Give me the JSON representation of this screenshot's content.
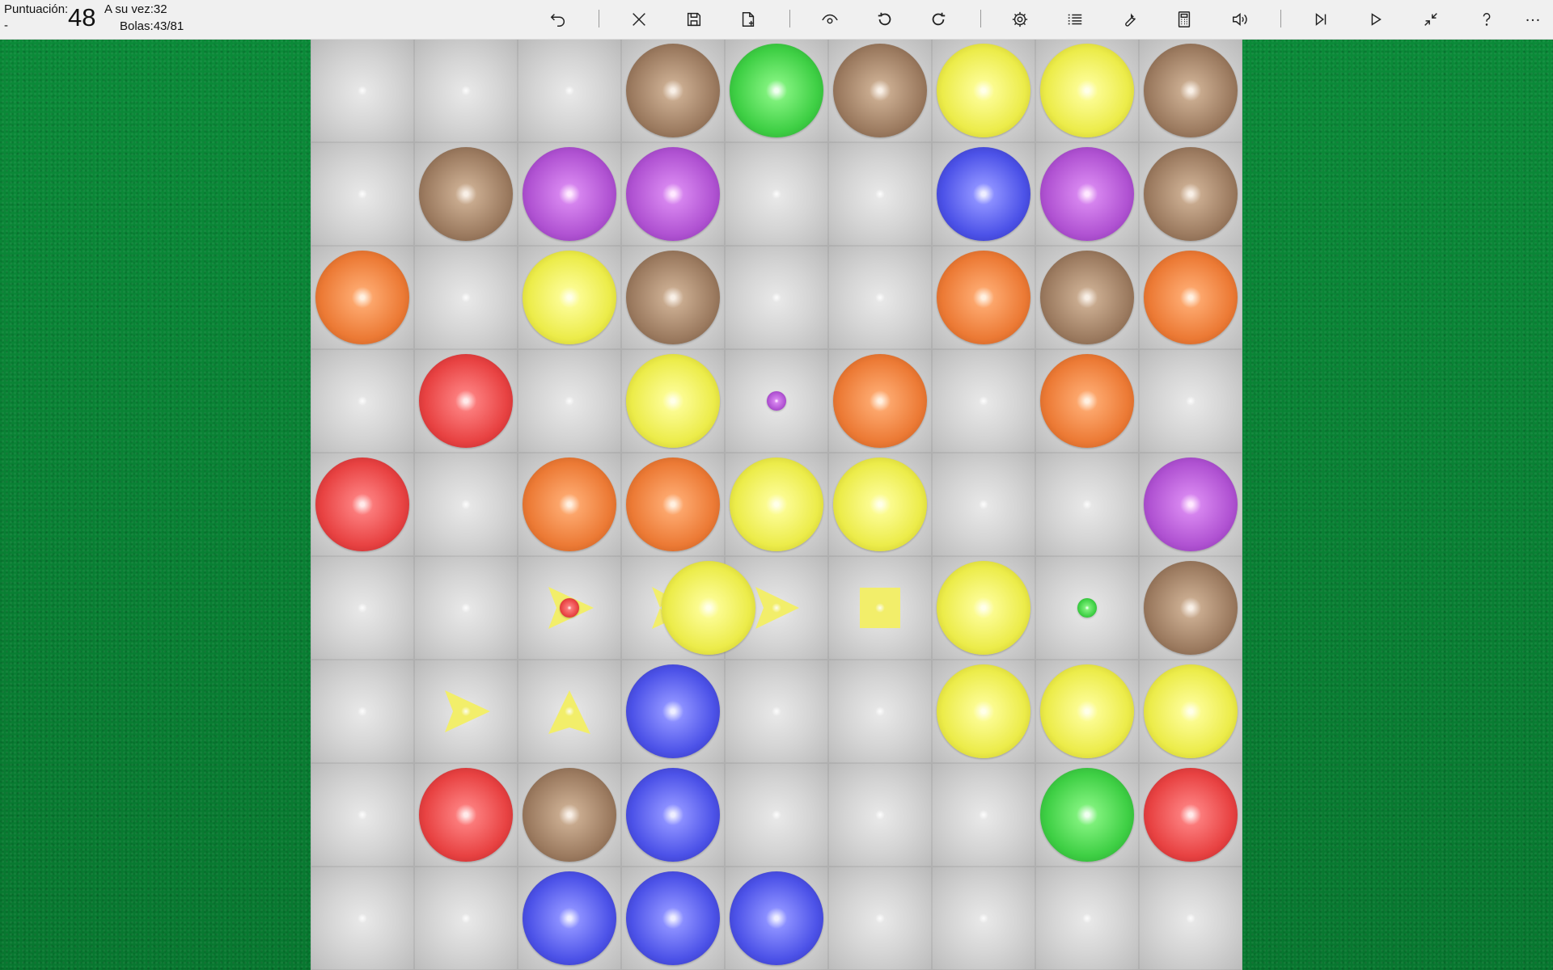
{
  "header": {
    "score_label": "Puntuación:",
    "score_value": "48",
    "score_dash": "-",
    "turn_text": "A su vez:32",
    "balls_text": "Bolas:43/81"
  },
  "toolbar": {
    "buttons": [
      {
        "name": "undo",
        "icon": "undo-icon"
      },
      {
        "name": "close",
        "icon": "close-icon"
      },
      {
        "name": "save",
        "icon": "save-icon"
      },
      {
        "name": "new-document",
        "icon": "document-icon"
      },
      {
        "name": "show",
        "icon": "eye-icon"
      },
      {
        "name": "rotate-left",
        "icon": "rotate-ccw-icon"
      },
      {
        "name": "rotate-right",
        "icon": "rotate-cw-icon"
      },
      {
        "name": "settings",
        "icon": "gear-icon"
      },
      {
        "name": "list",
        "icon": "list-icon"
      },
      {
        "name": "tools",
        "icon": "wrench-icon"
      },
      {
        "name": "calculator",
        "icon": "calculator-icon"
      },
      {
        "name": "sound",
        "icon": "speaker-icon"
      },
      {
        "name": "skip-next",
        "icon": "skip-next-icon"
      },
      {
        "name": "play",
        "icon": "play-icon"
      },
      {
        "name": "minimize",
        "icon": "shrink-icon"
      },
      {
        "name": "help",
        "icon": "question-icon"
      },
      {
        "name": "more",
        "icon": "more-icon"
      }
    ]
  },
  "colors": {
    "brown": [
      "#f8efe6",
      "#c7a98d",
      "#9c7b60",
      "#6a4e39"
    ],
    "green": [
      "#f0fff0",
      "#7df07a",
      "#3ecf44",
      "#21922a"
    ],
    "yellow": [
      "#ffffe8",
      "#fbfb8e",
      "#ecec4a",
      "#b9b21f"
    ],
    "purple": [
      "#ffe8ff",
      "#d583ee",
      "#b052d2",
      "#7a2ba0"
    ],
    "blue": [
      "#eeeeff",
      "#8a8eff",
      "#4c52e8",
      "#2a2aa4"
    ],
    "orange": [
      "#fff0e0",
      "#fca56a",
      "#ec7a35",
      "#b04f18"
    ],
    "red": [
      "#ffeaea",
      "#fb7a7a",
      "#e84242",
      "#a81e22"
    ]
  },
  "board": {
    "rows": 9,
    "cols": 9,
    "cells": [
      [
        "",
        "",
        "",
        "brown",
        "green",
        "brown",
        "yellow",
        "yellow",
        "brown"
      ],
      [
        "",
        "brown",
        "purple",
        "purple",
        "",
        "",
        "blue",
        "purple",
        "brown"
      ],
      [
        "orange",
        "",
        "yellow",
        "brown",
        "",
        "",
        "orange",
        "brown",
        "orange"
      ],
      [
        "",
        "red",
        "",
        "yellow",
        "purple-small",
        "orange",
        "",
        "orange",
        ""
      ],
      [
        "red",
        "",
        "orange",
        "orange",
        "yellow",
        "yellow",
        "",
        "",
        "purple"
      ],
      [
        "",
        "",
        "red-small",
        "yellow-selected",
        "",
        "",
        "yellow",
        "green-small",
        "brown"
      ],
      [
        "",
        "",
        "",
        "blue",
        "",
        "",
        "yellow",
        "yellow",
        "yellow"
      ],
      [
        "",
        "red",
        "brown",
        "blue",
        "",
        "",
        "",
        "green",
        "red"
      ],
      [
        "",
        "",
        "blue",
        "blue",
        "blue",
        "",
        "",
        "",
        ""
      ]
    ],
    "path_marker_color": "#f2ee6a"
  }
}
